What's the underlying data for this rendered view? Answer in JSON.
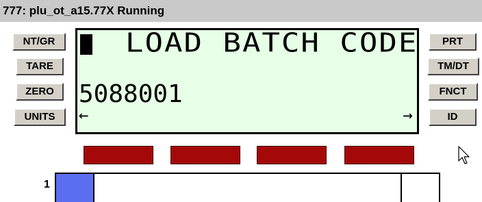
{
  "window": {
    "title": "777: plu_ot_a15.77X Running"
  },
  "left_buttons": [
    {
      "label": "NT/GR"
    },
    {
      "label": "TARE"
    },
    {
      "label": "ZERO"
    },
    {
      "label": "UNITS"
    }
  ],
  "right_buttons": [
    {
      "label": "PRT"
    },
    {
      "label": "TM/DT"
    },
    {
      "label": "FNCT"
    },
    {
      "label": "ID"
    }
  ],
  "display": {
    "prompt": "LOAD BATCH CODE",
    "value": "5088001",
    "left_arrow": "←",
    "right_arrow": "→",
    "background_color": "#e6ffe6"
  },
  "softkeys": {
    "count": 4,
    "color": "#a50808"
  },
  "bargraph": {
    "label": "1",
    "fill_fraction": 0.1,
    "marker_fraction": 0.9,
    "fill_color": "#5b6ef2"
  }
}
